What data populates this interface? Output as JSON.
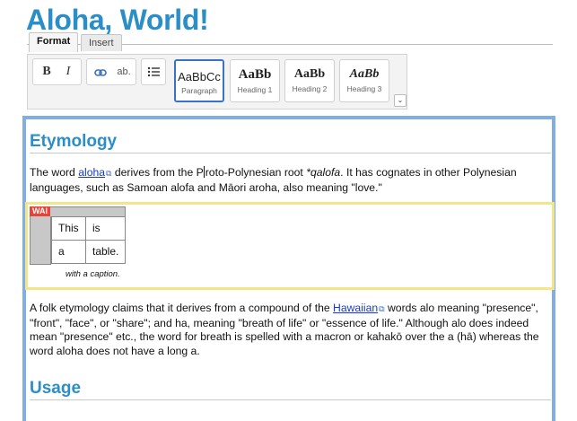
{
  "page": {
    "title": "Aloha, World!"
  },
  "toolbar": {
    "tabs": [
      {
        "label": "Format",
        "active": true
      },
      {
        "label": "Insert",
        "active": false
      }
    ],
    "buttons": {
      "bold": "B",
      "italic": "I",
      "link_icon": "link-icon",
      "unlink": "ab.",
      "list_icon": "list-icon"
    },
    "styles": [
      {
        "sample": "AaBbCc",
        "name": "Paragraph",
        "selected": true
      },
      {
        "sample": "AaBb",
        "name": "Heading 1",
        "selected": false
      },
      {
        "sample": "AaBb",
        "name": "Heading 2",
        "selected": false
      },
      {
        "sample": "AaBb",
        "name": "Heading 3",
        "selected": false
      }
    ],
    "expand_icon": "double-chevron-down-icon"
  },
  "content": {
    "heading1": "Etymology",
    "para1": {
      "before_link": "The word ",
      "link": "aloha",
      "after_link_1": " derives from the P",
      "after_caret": "roto-Polynesian root ",
      "italic": "*qalofa",
      "rest": ". It has cognates in other Polynesian languages, such as Samoan alofa and Māori aroha, also meaning \"love.\""
    },
    "table": {
      "badge": "WAI",
      "rows": [
        [
          "This",
          "is"
        ],
        [
          "a",
          "table."
        ]
      ],
      "caption": "with a caption."
    },
    "para2": {
      "before_link": "A folk etymology claims that it derives from a compound of the ",
      "link": "Hawaiian",
      "rest": " words alo meaning \"presence\", \"front\", \"face\", or \"share\"; and ha, meaning \"breath of life\" or \"essence of life.\" Although alo does indeed mean \"presence\" etc., the word for breath is spelled with a macron or kahakō over the a (hā) whereas the word aloha does not have a long a."
    },
    "heading2": "Usage"
  },
  "colors": {
    "title": "#2b8ec6",
    "editor_border": "#82aee6",
    "table_highlight": "#f3e58a",
    "badge": "#e6443a",
    "link": "#1a3bc7"
  }
}
